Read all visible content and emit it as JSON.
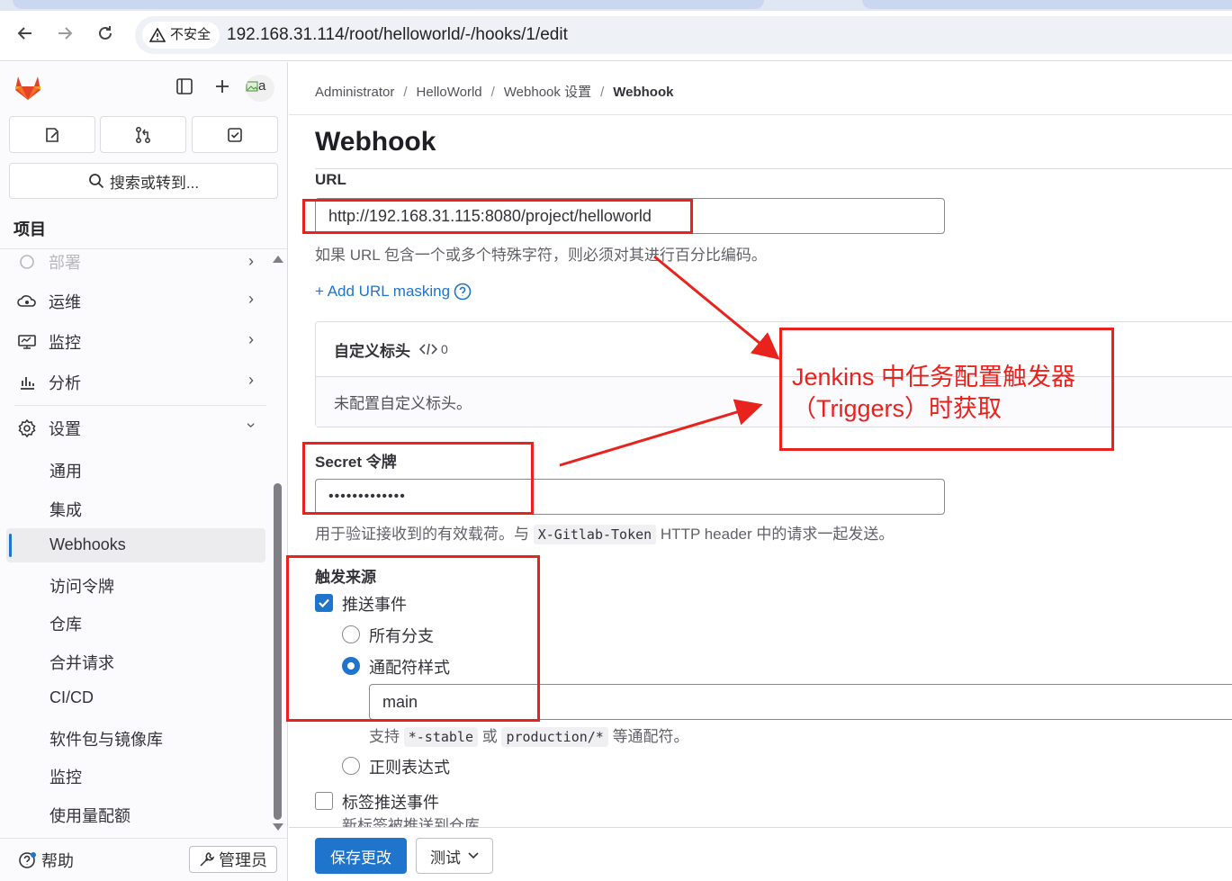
{
  "browser": {
    "insecure_label": "不安全",
    "url": "192.168.31.114/root/helloworld/-/hooks/1/edit"
  },
  "sidebar": {
    "avatar_text": "a",
    "search_label": "搜索或转到...",
    "section_title": "项目",
    "items": [
      {
        "label": "部署"
      },
      {
        "label": "运维"
      },
      {
        "label": "监控"
      },
      {
        "label": "分析"
      },
      {
        "label": "设置"
      }
    ],
    "settings_sub": [
      "通用",
      "集成",
      "Webhooks",
      "访问令牌",
      "仓库",
      "合并请求",
      "CI/CD",
      "软件包与镜像库",
      "监控",
      "使用量配额"
    ],
    "help_label": "帮助",
    "admin_label": "管理员"
  },
  "breadcrumb": {
    "items": [
      "Administrator",
      "HelloWorld",
      "Webhook 设置",
      "Webhook"
    ]
  },
  "page": {
    "title": "Webhook",
    "url_label": "URL",
    "url_value": "http://192.168.31.115:8080/project/helloworld",
    "url_help": "如果 URL 包含一个或多个特殊字符，则必须对其进行百分比编码。",
    "add_masking": "+ Add URL masking",
    "custom_headers": {
      "title": "自定义标头",
      "count": "0",
      "empty": "未配置自定义标头。"
    },
    "secret_label": "Secret 令牌",
    "secret_value": "•••••••••••••",
    "secret_help_pre": "用于验证接收到的有效载荷。与",
    "secret_help_code": "X-Gitlab-Token",
    "secret_help_post": "HTTP header 中的请求一起发送。",
    "triggers_label": "触发来源",
    "push_events": "推送事件",
    "all_branches": "所有分支",
    "wildcard": "通配符样式",
    "wildcard_value": "main",
    "wildcard_help_pre": "支持",
    "wildcard_help_code1": "*-stable",
    "wildcard_help_mid": "或",
    "wildcard_help_code2": "production/*",
    "wildcard_help_post": "等通配符。",
    "regex": "正则表达式",
    "tag_push": "标签推送事件",
    "tag_push_help": "新标签被推送到仓库。",
    "save_button": "保存更改",
    "test_button": "测试"
  },
  "annotation": {
    "text_line1": "Jenkins 中任务配置触发器",
    "text_line2": "（Triggers）时获取",
    "color": "#e8221c"
  },
  "colors": {
    "primary": "#1f75cb",
    "annotation_red": "#e8221c"
  }
}
